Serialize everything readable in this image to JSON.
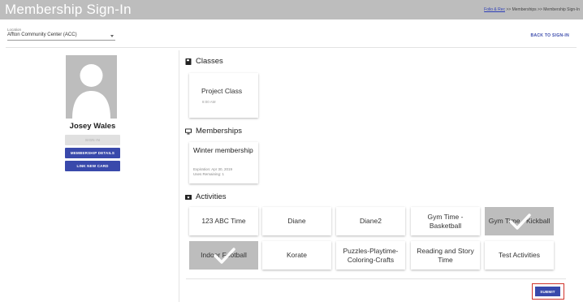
{
  "app": {
    "title": "Membership Sign-In"
  },
  "breadcrumb": {
    "link": "Folio & Rec",
    "separator1": ">>",
    "item1": "Memberships",
    "separator2": ">>",
    "item2": "Membership Sign-In"
  },
  "location": {
    "label": "Location",
    "value": "Affton Community Center (ACC)"
  },
  "back_link": "BACK TO SIGN-IN",
  "member": {
    "name": "Josey Wales",
    "buttons": {
      "sign_in": "SIGN IN",
      "membership_details": "MEMBERSHIP DETAILS",
      "link_new_card": "LINK NEW CARD"
    }
  },
  "sections": {
    "classes": "Classes",
    "memberships": "Memberships",
    "activities": "Activities"
  },
  "classes": [
    {
      "title": "Project Class",
      "time": "8:00 AM"
    }
  ],
  "memberships": [
    {
      "title": "Winter membership",
      "expiration": "Expiration: Apr 30, 2019",
      "uses": "Uses Remaining: 1"
    }
  ],
  "activities": [
    {
      "label": "123 ABC Time",
      "selected": false
    },
    {
      "label": "Diane",
      "selected": false
    },
    {
      "label": "Diane2",
      "selected": false
    },
    {
      "label": "Gym Time - Basketball",
      "selected": false
    },
    {
      "label": "Gym Time - Kickball",
      "selected": true
    },
    {
      "label": "Indoor Football",
      "selected": true
    },
    {
      "label": "Korate",
      "selected": false
    },
    {
      "label": "Puzzles-Playtime-Coloring-Crafts",
      "selected": false
    },
    {
      "label": "Reading and Story Time",
      "selected": false
    },
    {
      "label": "Test Activities",
      "selected": false
    }
  ],
  "submit_label": "SUBMIT",
  "colors": {
    "primary": "#3949ab",
    "topbar": "#bdbdbd",
    "selected_tile": "#bdbdbd",
    "highlight_border": "#d0342c"
  },
  "icons": {
    "classes": "book-icon",
    "memberships": "monitor-icon",
    "activities": "ticket-icon",
    "selected": "checkmark-icon",
    "location": "chevron-down-icon"
  }
}
